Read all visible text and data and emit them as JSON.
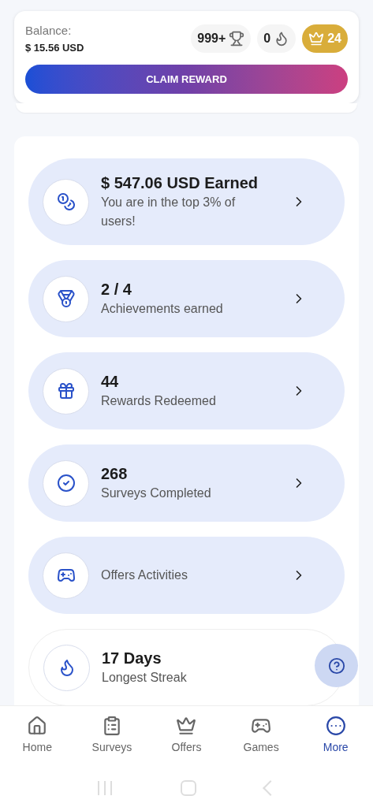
{
  "balance": {
    "label": "Balance:",
    "value": "$ 15.56 USD"
  },
  "badges": [
    {
      "kind": "trophy",
      "text": "999+"
    },
    {
      "kind": "flame",
      "text": "0"
    },
    {
      "kind": "crown",
      "text": "24"
    }
  ],
  "claim_button": "CLAIM REWARD",
  "stats": [
    {
      "kind": "link",
      "title": "$ 547.06 USD Earned",
      "subtitle": "You are in the top 3% of users!"
    },
    {
      "kind": "link",
      "title": "2 / 4",
      "subtitle": "Achievements earned"
    },
    {
      "kind": "link",
      "title": "44",
      "subtitle": "Rewards Redeemed"
    },
    {
      "kind": "link",
      "title": "268",
      "subtitle": "Surveys Completed"
    },
    {
      "kind": "link",
      "subtitle": "Offers Activities"
    },
    {
      "kind": "plain",
      "title": "17 Days",
      "subtitle": "Longest Streak"
    }
  ],
  "nav": [
    {
      "label": "Home",
      "selected": false
    },
    {
      "label": "Surveys",
      "selected": false
    },
    {
      "label": "Offers",
      "selected": false
    },
    {
      "label": "Games",
      "selected": false
    },
    {
      "label": "More",
      "selected": true
    }
  ]
}
